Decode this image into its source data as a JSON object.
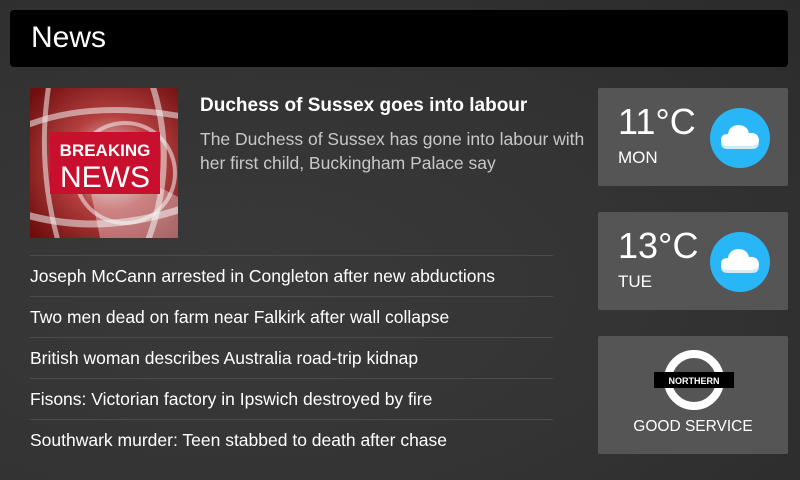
{
  "header": {
    "title": "News"
  },
  "featured": {
    "image_caption_line1": "BREAKING",
    "image_caption_line2": "NEWS",
    "title": "Duchess of Sussex goes into labour",
    "summary": "The Duchess of Sussex has gone into labour with her first child, Buckingham Palace say"
  },
  "headlines": [
    "Joseph McCann arrested in Congleton after new abductions",
    "Two men dead on farm near Falkirk after wall collapse",
    "British woman describes Australia road-trip kidnap",
    "Fisons: Victorian factory in Ipswich destroyed by fire",
    "Southwark murder: Teen stabbed to death after chase"
  ],
  "weather": [
    {
      "temp": "11°C",
      "day": "MON",
      "icon": "cloud-icon"
    },
    {
      "temp": "13°C",
      "day": "TUE",
      "icon": "cloud-icon"
    }
  ],
  "tube": {
    "line": "NORTHERN",
    "status": "GOOD SERVICE",
    "icon": "london-underground-roundel-icon"
  },
  "colors": {
    "background": "#333333",
    "header_bg": "#000000",
    "card_bg": "#555555",
    "weather_icon_bg": "#29b6f6",
    "breaking_red": "#c8102e"
  }
}
